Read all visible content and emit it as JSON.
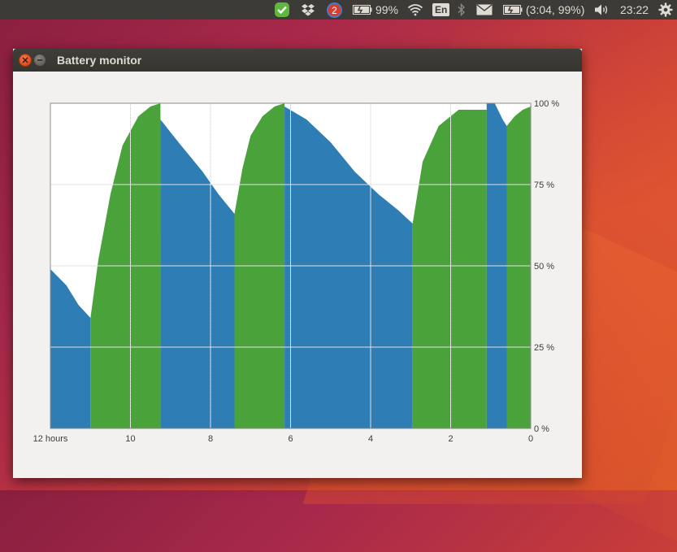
{
  "desktop": {
    "wallpaper_colors": [
      "#8a1f3f",
      "#c63c3a",
      "#dd5a2a"
    ]
  },
  "panel": {
    "indicators": [
      {
        "name": "sync-check-icon",
        "color": "#5fb740"
      },
      {
        "name": "dropbox-icon"
      },
      {
        "name": "notification-icon",
        "badge": "2",
        "color": "#d43f2f"
      },
      {
        "name": "battery-icon",
        "text": "99%"
      },
      {
        "name": "wifi-icon"
      },
      {
        "name": "keyboard-layout",
        "text": "En"
      },
      {
        "name": "bluetooth-icon"
      },
      {
        "name": "mail-icon"
      },
      {
        "name": "battery-icon-2",
        "text": "(3:04, 99%)"
      },
      {
        "name": "volume-icon"
      },
      {
        "name": "clock",
        "text": "23:22"
      },
      {
        "name": "settings-gear-icon"
      }
    ]
  },
  "window": {
    "title": "Battery monitor"
  },
  "chart_data": {
    "type": "area",
    "x_axis": {
      "ticks": [
        "12 hours",
        "10",
        "8",
        "6",
        "4",
        "2",
        "0"
      ],
      "range": [
        12,
        0
      ]
    },
    "y_axis": {
      "ticks": [
        "0 %",
        "25 %",
        "50 %",
        "75 %",
        "100 %"
      ],
      "range": [
        0,
        100
      ]
    },
    "colors": {
      "charging": "#4aa33a",
      "discharging": "#2e7db5",
      "grid": "#dcdcdc"
    },
    "segments": [
      {
        "state": "discharging",
        "points": [
          [
            12,
            49
          ],
          [
            11.6,
            44
          ],
          [
            11.3,
            38
          ],
          [
            11.0,
            34
          ]
        ]
      },
      {
        "state": "charging",
        "points": [
          [
            11.0,
            34
          ],
          [
            10.8,
            52
          ],
          [
            10.5,
            72
          ],
          [
            10.2,
            87
          ],
          [
            9.8,
            96
          ],
          [
            9.5,
            99
          ],
          [
            9.25,
            100
          ]
        ]
      },
      {
        "state": "discharging",
        "points": [
          [
            9.25,
            95
          ],
          [
            8.8,
            88
          ],
          [
            8.2,
            79
          ],
          [
            7.8,
            72
          ],
          [
            7.4,
            66
          ]
        ]
      },
      {
        "state": "charging",
        "points": [
          [
            7.4,
            66
          ],
          [
            7.2,
            80
          ],
          [
            7.0,
            90
          ],
          [
            6.7,
            96
          ],
          [
            6.4,
            99
          ],
          [
            6.15,
            100
          ]
        ]
      },
      {
        "state": "discharging",
        "points": [
          [
            6.15,
            99
          ],
          [
            5.6,
            95
          ],
          [
            5.0,
            88
          ],
          [
            4.4,
            79
          ],
          [
            3.8,
            72
          ],
          [
            3.3,
            67
          ],
          [
            2.95,
            63
          ]
        ]
      },
      {
        "state": "charging",
        "points": [
          [
            2.95,
            63
          ],
          [
            2.7,
            82
          ],
          [
            2.3,
            93
          ],
          [
            1.8,
            98
          ],
          [
            1.3,
            98
          ],
          [
            1.1,
            98
          ]
        ]
      },
      {
        "state": "discharging",
        "points": [
          [
            1.1,
            100
          ],
          [
            0.9,
            100
          ],
          [
            0.7,
            95
          ],
          [
            0.6,
            93
          ]
        ]
      },
      {
        "state": "charging",
        "points": [
          [
            0.6,
            93
          ],
          [
            0.4,
            96
          ],
          [
            0.2,
            98
          ],
          [
            0.0,
            99
          ]
        ]
      }
    ],
    "grid": true
  }
}
